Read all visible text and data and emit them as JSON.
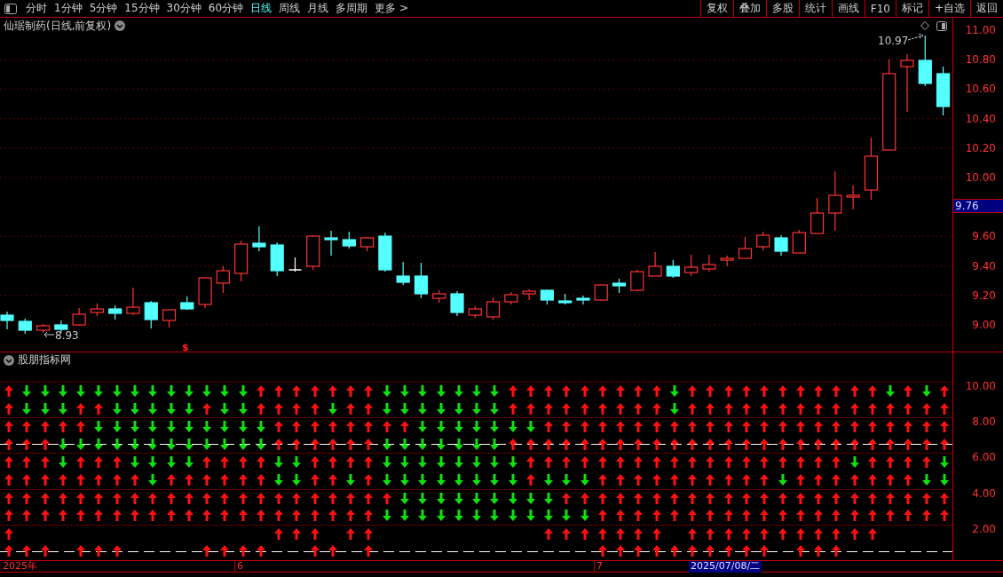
{
  "toolbar": {
    "periods": [
      {
        "label": "分时",
        "selected": false
      },
      {
        "label": "1分钟",
        "selected": false
      },
      {
        "label": "5分钟",
        "selected": false
      },
      {
        "label": "15分钟",
        "selected": false
      },
      {
        "label": "30分钟",
        "selected": false
      },
      {
        "label": "60分钟",
        "selected": false
      },
      {
        "label": "日线",
        "selected": true
      },
      {
        "label": "周线",
        "selected": false
      },
      {
        "label": "月线",
        "selected": false
      },
      {
        "label": "多周期",
        "selected": false
      },
      {
        "label": "更多 >",
        "selected": false
      }
    ],
    "actions": [
      "复权",
      "叠加",
      "多股",
      "统计",
      "画线",
      "F10",
      "标记",
      "+自选",
      "返回"
    ]
  },
  "chart": {
    "title": "仙琚制药(日线,前复权)",
    "ticks": [
      "11.00",
      "10.80",
      "10.60",
      "10.40",
      "10.20",
      "10.00",
      "9.60",
      "9.40",
      "9.20",
      "9.00"
    ],
    "current_price": "9.76",
    "high_marker": "10.97",
    "low_marker": "8.93",
    "signal_marker": "$"
  },
  "indicator": {
    "title": "股朋指标网",
    "ticks": [
      "10.00",
      "8.00",
      "6.00",
      "4.00",
      "2.00"
    ],
    "rows": [
      {
        "kind": "plain",
        "cells": [
          {
            "kind": "up"
          },
          {
            "kind": "down"
          },
          {
            "kind": "down"
          },
          {
            "kind": "down"
          },
          {
            "kind": "down"
          },
          {
            "kind": "down"
          },
          {
            "kind": "down"
          },
          {
            "kind": "down"
          },
          {
            "kind": "down"
          },
          {
            "kind": "down"
          },
          {
            "kind": "down"
          },
          {
            "kind": "down"
          },
          {
            "kind": "down"
          },
          {
            "kind": "down"
          },
          {
            "kind": "up"
          },
          {
            "kind": "up"
          },
          {
            "kind": "up"
          },
          {
            "kind": "up"
          },
          {
            "kind": "up"
          },
          {
            "kind": "up"
          },
          {
            "kind": "up"
          },
          {
            "kind": "down"
          },
          {
            "kind": "down"
          },
          {
            "kind": "down"
          },
          {
            "kind": "down"
          },
          {
            "kind": "down"
          },
          {
            "kind": "down"
          },
          {
            "kind": "down"
          },
          {
            "kind": "up"
          },
          {
            "kind": "up"
          },
          {
            "kind": "up"
          },
          {
            "kind": "up"
          },
          {
            "kind": "up"
          },
          {
            "kind": "up"
          },
          {
            "kind": "up"
          },
          {
            "kind": "up"
          },
          {
            "kind": "up"
          },
          {
            "kind": "down"
          },
          {
            "kind": "up"
          },
          {
            "kind": "up"
          },
          {
            "kind": "up"
          },
          {
            "kind": "up"
          },
          {
            "kind": "up"
          },
          {
            "kind": "up"
          },
          {
            "kind": "up"
          },
          {
            "kind": "up"
          },
          {
            "kind": "up"
          },
          {
            "kind": "up"
          },
          {
            "kind": "up"
          },
          {
            "kind": "down"
          },
          {
            "kind": "up"
          },
          {
            "kind": "down"
          },
          {
            "kind": "up"
          }
        ]
      },
      {
        "kind": "plain",
        "cells": [
          {
            "kind": "up"
          },
          {
            "kind": "down"
          },
          {
            "kind": "down"
          },
          {
            "kind": "down"
          },
          {
            "kind": "up"
          },
          {
            "kind": "up"
          },
          {
            "kind": "down"
          },
          {
            "kind": "down"
          },
          {
            "kind": "down"
          },
          {
            "kind": "down"
          },
          {
            "kind": "down"
          },
          {
            "kind": "up"
          },
          {
            "kind": "down"
          },
          {
            "kind": "down"
          },
          {
            "kind": "up"
          },
          {
            "kind": "up"
          },
          {
            "kind": "up"
          },
          {
            "kind": "up"
          },
          {
            "kind": "down"
          },
          {
            "kind": "up"
          },
          {
            "kind": "up"
          },
          {
            "kind": "down"
          },
          {
            "kind": "down"
          },
          {
            "kind": "down"
          },
          {
            "kind": "down"
          },
          {
            "kind": "down"
          },
          {
            "kind": "down"
          },
          {
            "kind": "down"
          },
          {
            "kind": "up"
          },
          {
            "kind": "up"
          },
          {
            "kind": "up"
          },
          {
            "kind": "up"
          },
          {
            "kind": "up"
          },
          {
            "kind": "up"
          },
          {
            "kind": "up"
          },
          {
            "kind": "up"
          },
          {
            "kind": "up"
          },
          {
            "kind": "down"
          },
          {
            "kind": "up"
          },
          {
            "kind": "up"
          },
          {
            "kind": "up"
          },
          {
            "kind": "up"
          },
          {
            "kind": "up"
          },
          {
            "kind": "up"
          },
          {
            "kind": "up"
          },
          {
            "kind": "up"
          },
          {
            "kind": "up"
          },
          {
            "kind": "up"
          },
          {
            "kind": "up"
          },
          {
            "kind": "up"
          },
          {
            "kind": "up"
          },
          {
            "kind": "up"
          },
          {
            "kind": "up"
          }
        ]
      },
      {
        "kind": "plain",
        "cells": [
          {
            "kind": "up"
          },
          {
            "kind": "up"
          },
          {
            "kind": "up"
          },
          {
            "kind": "up"
          },
          {
            "kind": "up"
          },
          {
            "kind": "down"
          },
          {
            "kind": "down"
          },
          {
            "kind": "down"
          },
          {
            "kind": "down"
          },
          {
            "kind": "down"
          },
          {
            "kind": "down"
          },
          {
            "kind": "down"
          },
          {
            "kind": "down"
          },
          {
            "kind": "down"
          },
          {
            "kind": "down"
          },
          {
            "kind": "up"
          },
          {
            "kind": "up"
          },
          {
            "kind": "up"
          },
          {
            "kind": "up"
          },
          {
            "kind": "up"
          },
          {
            "kind": "up"
          },
          {
            "kind": "up"
          },
          {
            "kind": "up"
          },
          {
            "kind": "down"
          },
          {
            "kind": "down"
          },
          {
            "kind": "down"
          },
          {
            "kind": "down"
          },
          {
            "kind": "down"
          },
          {
            "kind": "down"
          },
          {
            "kind": "down"
          },
          {
            "kind": "up"
          },
          {
            "kind": "up"
          },
          {
            "kind": "up"
          },
          {
            "kind": "up"
          },
          {
            "kind": "up"
          },
          {
            "kind": "up"
          },
          {
            "kind": "up"
          },
          {
            "kind": "up"
          },
          {
            "kind": "up"
          },
          {
            "kind": "up"
          },
          {
            "kind": "up"
          },
          {
            "kind": "up"
          },
          {
            "kind": "up"
          },
          {
            "kind": "up"
          },
          {
            "kind": "up"
          },
          {
            "kind": "up"
          },
          {
            "kind": "up"
          },
          {
            "kind": "up"
          },
          {
            "kind": "up"
          },
          {
            "kind": "up"
          },
          {
            "kind": "up"
          },
          {
            "kind": "up"
          },
          {
            "kind": "up"
          }
        ]
      },
      {
        "kind": "dashed",
        "cells": [
          {
            "kind": "up"
          },
          {
            "kind": "up"
          },
          {
            "kind": "up"
          },
          {
            "kind": "down"
          },
          {
            "kind": "down"
          },
          {
            "kind": "down"
          },
          {
            "kind": "down"
          },
          {
            "kind": "down"
          },
          {
            "kind": "down"
          },
          {
            "kind": "down"
          },
          {
            "kind": "down"
          },
          {
            "kind": "down"
          },
          {
            "kind": "down"
          },
          {
            "kind": "down"
          },
          {
            "kind": "down"
          },
          {
            "kind": "up"
          },
          {
            "kind": "up"
          },
          {
            "kind": "up"
          },
          {
            "kind": "up"
          },
          {
            "kind": "up"
          },
          {
            "kind": "up"
          },
          {
            "kind": "down"
          },
          {
            "kind": "down"
          },
          {
            "kind": "down"
          },
          {
            "kind": "down"
          },
          {
            "kind": "down"
          },
          {
            "kind": "down"
          },
          {
            "kind": "down"
          },
          {
            "kind": "up"
          },
          {
            "kind": "up"
          },
          {
            "kind": "up"
          },
          {
            "kind": "up"
          },
          {
            "kind": "up"
          },
          {
            "kind": "up"
          },
          {
            "kind": "up"
          },
          {
            "kind": "up"
          },
          {
            "kind": "up"
          },
          {
            "kind": "up"
          },
          {
            "kind": "up"
          },
          {
            "kind": "up"
          },
          {
            "kind": "up"
          },
          {
            "kind": "up"
          },
          {
            "kind": "up"
          },
          {
            "kind": "up"
          },
          {
            "kind": "up"
          },
          {
            "kind": "up"
          },
          {
            "kind": "up"
          },
          {
            "kind": "up"
          },
          {
            "kind": "up"
          },
          {
            "kind": "up"
          },
          {
            "kind": "up"
          },
          {
            "kind": "up"
          },
          {
            "kind": "up"
          }
        ]
      },
      {
        "kind": "plain",
        "cells": [
          {
            "kind": "up"
          },
          {
            "kind": "up"
          },
          {
            "kind": "up"
          },
          {
            "kind": "down"
          },
          {
            "kind": "up"
          },
          {
            "kind": "up"
          },
          {
            "kind": "up"
          },
          {
            "kind": "down"
          },
          {
            "kind": "down"
          },
          {
            "kind": "down"
          },
          {
            "kind": "down"
          },
          {
            "kind": "up"
          },
          {
            "kind": "up"
          },
          {
            "kind": "up"
          },
          {
            "kind": "up"
          },
          {
            "kind": "down"
          },
          {
            "kind": "down"
          },
          {
            "kind": "up"
          },
          {
            "kind": "up"
          },
          {
            "kind": "up"
          },
          {
            "kind": "up"
          },
          {
            "kind": "down"
          },
          {
            "kind": "down"
          },
          {
            "kind": "down"
          },
          {
            "kind": "down"
          },
          {
            "kind": "down"
          },
          {
            "kind": "down"
          },
          {
            "kind": "down"
          },
          {
            "kind": "down"
          },
          {
            "kind": "up"
          },
          {
            "kind": "up"
          },
          {
            "kind": "up"
          },
          {
            "kind": "up"
          },
          {
            "kind": "up"
          },
          {
            "kind": "up"
          },
          {
            "kind": "up"
          },
          {
            "kind": "up"
          },
          {
            "kind": "up"
          },
          {
            "kind": "up"
          },
          {
            "kind": "up"
          },
          {
            "kind": "up"
          },
          {
            "kind": "up"
          },
          {
            "kind": "up"
          },
          {
            "kind": "up"
          },
          {
            "kind": "up"
          },
          {
            "kind": "up"
          },
          {
            "kind": "up"
          },
          {
            "kind": "down"
          },
          {
            "kind": "up"
          },
          {
            "kind": "up"
          },
          {
            "kind": "up"
          },
          {
            "kind": "up"
          },
          {
            "kind": "down"
          }
        ]
      },
      {
        "kind": "plain",
        "cells": [
          {
            "kind": "up"
          },
          {
            "kind": "up"
          },
          {
            "kind": "up"
          },
          {
            "kind": "up"
          },
          {
            "kind": "up"
          },
          {
            "kind": "up"
          },
          {
            "kind": "up"
          },
          {
            "kind": "up"
          },
          {
            "kind": "down"
          },
          {
            "kind": "up"
          },
          {
            "kind": "up"
          },
          {
            "kind": "up"
          },
          {
            "kind": "up"
          },
          {
            "kind": "up"
          },
          {
            "kind": "up"
          },
          {
            "kind": "down"
          },
          {
            "kind": "down"
          },
          {
            "kind": "up"
          },
          {
            "kind": "up"
          },
          {
            "kind": "down"
          },
          {
            "kind": "up"
          },
          {
            "kind": "down"
          },
          {
            "kind": "down"
          },
          {
            "kind": "down"
          },
          {
            "kind": "down"
          },
          {
            "kind": "down"
          },
          {
            "kind": "down"
          },
          {
            "kind": "down"
          },
          {
            "kind": "down"
          },
          {
            "kind": "up"
          },
          {
            "kind": "down"
          },
          {
            "kind": "down"
          },
          {
            "kind": "down"
          },
          {
            "kind": "up"
          },
          {
            "kind": "up"
          },
          {
            "kind": "up"
          },
          {
            "kind": "up"
          },
          {
            "kind": "up"
          },
          {
            "kind": "up"
          },
          {
            "kind": "up"
          },
          {
            "kind": "up"
          },
          {
            "kind": "up"
          },
          {
            "kind": "up"
          },
          {
            "kind": "down"
          },
          {
            "kind": "up"
          },
          {
            "kind": "up"
          },
          {
            "kind": "up"
          },
          {
            "kind": "up"
          },
          {
            "kind": "up"
          },
          {
            "kind": "up"
          },
          {
            "kind": "up"
          },
          {
            "kind": "down"
          },
          {
            "kind": "down"
          }
        ]
      },
      {
        "kind": "plain",
        "cells": [
          {
            "kind": "up"
          },
          {
            "kind": "up"
          },
          {
            "kind": "up"
          },
          {
            "kind": "up"
          },
          {
            "kind": "up"
          },
          {
            "kind": "up"
          },
          {
            "kind": "up"
          },
          {
            "kind": "up"
          },
          {
            "kind": "up"
          },
          {
            "kind": "up"
          },
          {
            "kind": "up"
          },
          {
            "kind": "up"
          },
          {
            "kind": "up"
          },
          {
            "kind": "up"
          },
          {
            "kind": "up"
          },
          {
            "kind": "up"
          },
          {
            "kind": "up"
          },
          {
            "kind": "up"
          },
          {
            "kind": "up"
          },
          {
            "kind": "up"
          },
          {
            "kind": "up"
          },
          {
            "kind": "up"
          },
          {
            "kind": "down"
          },
          {
            "kind": "down"
          },
          {
            "kind": "down"
          },
          {
            "kind": "down"
          },
          {
            "kind": "down"
          },
          {
            "kind": "down"
          },
          {
            "kind": "down"
          },
          {
            "kind": "down"
          },
          {
            "kind": "down"
          },
          {
            "kind": "up"
          },
          {
            "kind": "up"
          },
          {
            "kind": "up"
          },
          {
            "kind": "up"
          },
          {
            "kind": "up"
          },
          {
            "kind": "up"
          },
          {
            "kind": "up"
          },
          {
            "kind": "up"
          },
          {
            "kind": "up"
          },
          {
            "kind": "up"
          },
          {
            "kind": "up"
          },
          {
            "kind": "up"
          },
          {
            "kind": "up"
          },
          {
            "kind": "up"
          },
          {
            "kind": "up"
          },
          {
            "kind": "up"
          },
          {
            "kind": "up"
          },
          {
            "kind": "up"
          },
          {
            "kind": "up"
          },
          {
            "kind": "up"
          },
          {
            "kind": "up"
          },
          {
            "kind": "up"
          }
        ]
      },
      {
        "kind": "plain",
        "cells": [
          {
            "kind": "up"
          },
          {
            "kind": "up"
          },
          {
            "kind": "up"
          },
          {
            "kind": "up"
          },
          {
            "kind": "up"
          },
          {
            "kind": "up"
          },
          {
            "kind": "up"
          },
          {
            "kind": "up"
          },
          {
            "kind": "up"
          },
          {
            "kind": "up"
          },
          {
            "kind": "up"
          },
          {
            "kind": "up"
          },
          {
            "kind": "up"
          },
          {
            "kind": "up"
          },
          {
            "kind": "up"
          },
          {
            "kind": "up"
          },
          {
            "kind": "up"
          },
          {
            "kind": "up"
          },
          {
            "kind": "up"
          },
          {
            "kind": "up"
          },
          {
            "kind": "up"
          },
          {
            "kind": "down"
          },
          {
            "kind": "down"
          },
          {
            "kind": "down"
          },
          {
            "kind": "down"
          },
          {
            "kind": "down"
          },
          {
            "kind": "down"
          },
          {
            "kind": "down"
          },
          {
            "kind": "down"
          },
          {
            "kind": "down"
          },
          {
            "kind": "down"
          },
          {
            "kind": "down"
          },
          {
            "kind": "down"
          },
          {
            "kind": "up"
          },
          {
            "kind": "up"
          },
          {
            "kind": "up"
          },
          {
            "kind": "up"
          },
          {
            "kind": "up"
          },
          {
            "kind": "up"
          },
          {
            "kind": "up"
          },
          {
            "kind": "up"
          },
          {
            "kind": "up"
          },
          {
            "kind": "up"
          },
          {
            "kind": "up"
          },
          {
            "kind": "up"
          },
          {
            "kind": "up"
          },
          {
            "kind": "up"
          },
          {
            "kind": "up"
          },
          {
            "kind": "up"
          },
          {
            "kind": "up"
          },
          {
            "kind": "up"
          },
          {
            "kind": "up"
          },
          {
            "kind": "up"
          }
        ]
      },
      {
        "kind": "plain",
        "cells": [
          {
            "kind": "up"
          },
          {
            "kind": "blank"
          },
          {
            "kind": "blank"
          },
          {
            "kind": "blank"
          },
          {
            "kind": "blank"
          },
          {
            "kind": "blank"
          },
          {
            "kind": "blank"
          },
          {
            "kind": "blank"
          },
          {
            "kind": "blank"
          },
          {
            "kind": "blank"
          },
          {
            "kind": "blank"
          },
          {
            "kind": "blank"
          },
          {
            "kind": "blank"
          },
          {
            "kind": "blank"
          },
          {
            "kind": "blank"
          },
          {
            "kind": "up"
          },
          {
            "kind": "up"
          },
          {
            "kind": "up"
          },
          {
            "kind": "blank"
          },
          {
            "kind": "up"
          },
          {
            "kind": "up"
          },
          {
            "kind": "blank"
          },
          {
            "kind": "blank"
          },
          {
            "kind": "blank"
          },
          {
            "kind": "blank"
          },
          {
            "kind": "blank"
          },
          {
            "kind": "blank"
          },
          {
            "kind": "blank"
          },
          {
            "kind": "blank"
          },
          {
            "kind": "blank"
          },
          {
            "kind": "up"
          },
          {
            "kind": "up"
          },
          {
            "kind": "up"
          },
          {
            "kind": "up"
          },
          {
            "kind": "up"
          },
          {
            "kind": "up"
          },
          {
            "kind": "up"
          },
          {
            "kind": "blank"
          },
          {
            "kind": "up"
          },
          {
            "kind": "up"
          },
          {
            "kind": "up"
          },
          {
            "kind": "up"
          },
          {
            "kind": "up"
          },
          {
            "kind": "up"
          },
          {
            "kind": "up"
          },
          {
            "kind": "up"
          },
          {
            "kind": "up"
          },
          {
            "kind": "up"
          },
          {
            "kind": "up"
          },
          {
            "kind": "blank"
          },
          {
            "kind": "blank"
          },
          {
            "kind": "blank"
          },
          {
            "kind": "blank"
          }
        ]
      },
      {
        "kind": "dashed",
        "cells": [
          {
            "kind": "up"
          },
          {
            "kind": "up"
          },
          {
            "kind": "up"
          },
          {
            "kind": "blank"
          },
          {
            "kind": "up"
          },
          {
            "kind": "up"
          },
          {
            "kind": "up"
          },
          {
            "kind": "blank"
          },
          {
            "kind": "blank"
          },
          {
            "kind": "blank"
          },
          {
            "kind": "blank"
          },
          {
            "kind": "up"
          },
          {
            "kind": "up"
          },
          {
            "kind": "up"
          },
          {
            "kind": "up"
          },
          {
            "kind": "blank"
          },
          {
            "kind": "blank"
          },
          {
            "kind": "up"
          },
          {
            "kind": "up"
          },
          {
            "kind": "blank"
          },
          {
            "kind": "up"
          },
          {
            "kind": "blank"
          },
          {
            "kind": "blank"
          },
          {
            "kind": "blank"
          },
          {
            "kind": "blank"
          },
          {
            "kind": "blank"
          },
          {
            "kind": "blank"
          },
          {
            "kind": "blank"
          },
          {
            "kind": "blank"
          },
          {
            "kind": "blank"
          },
          {
            "kind": "blank"
          },
          {
            "kind": "blank"
          },
          {
            "kind": "blank"
          },
          {
            "kind": "up"
          },
          {
            "kind": "up"
          },
          {
            "kind": "up"
          },
          {
            "kind": "up"
          },
          {
            "kind": "up"
          },
          {
            "kind": "up"
          },
          {
            "kind": "up"
          },
          {
            "kind": "up"
          },
          {
            "kind": "up"
          },
          {
            "kind": "up"
          },
          {
            "kind": "blank"
          },
          {
            "kind": "up"
          },
          {
            "kind": "up"
          },
          {
            "kind": "up"
          },
          {
            "kind": "blank"
          },
          {
            "kind": "blank"
          },
          {
            "kind": "blank"
          },
          {
            "kind": "blank"
          },
          {
            "kind": "blank"
          },
          {
            "kind": "blank"
          }
        ]
      }
    ]
  },
  "date_axis": {
    "labels": [
      "2025年",
      "6",
      "7"
    ],
    "cursor_date": "2025/07/08/二"
  }
}
